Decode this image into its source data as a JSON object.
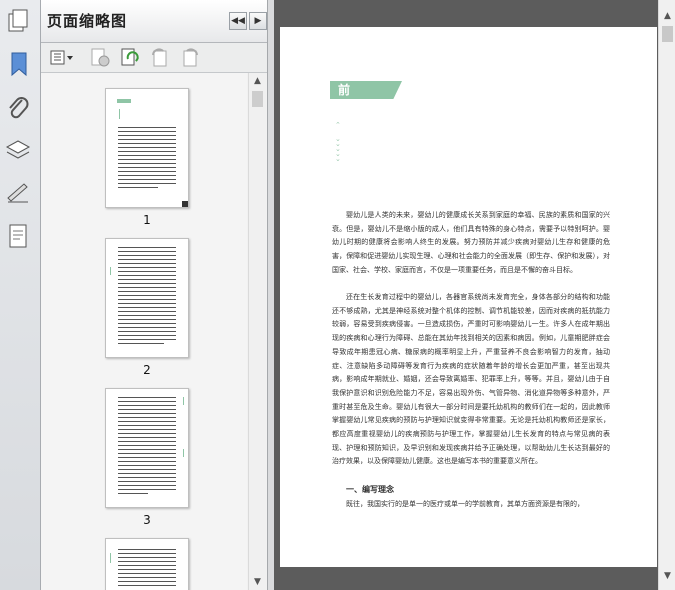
{
  "panel": {
    "title": "页面缩略图",
    "collapse_icon": "double-chevron-left-icon",
    "expand_icon": "chevron-right-icon"
  },
  "rail": {
    "icons": [
      "pages-icon",
      "bookmark-icon",
      "attachment-icon",
      "layers-icon",
      "signature-icon",
      "content-icon"
    ]
  },
  "toolbar": {
    "icons": [
      "options-menu-icon",
      "delete-pages-icon",
      "replace-pages-icon",
      "rotate-left-icon",
      "rotate-right-icon"
    ]
  },
  "thumbnails": [
    {
      "label": "1"
    },
    {
      "label": "2"
    },
    {
      "label": "3"
    },
    {
      "label": ""
    }
  ],
  "document": {
    "heading": "前 言",
    "paragraphs": [
      "婴幼儿是人类的未来，婴幼儿的健康成长关系到家庭的幸福、民族的素质和国家的兴衰。但是，婴幼儿不是缩小版的成人，他们具有特殊的身心特点，需要予以特别呵护。婴幼儿时期的健康将会影响人终生的发展。努力预防并减少疾病对婴幼儿生存和健康的危害，保障和促进婴幼儿实现生理、心理和社会能力的全面发展（即生存、保护和发展），对国家、社会、学校、家庭而言，不仅是一项重要任务，而且是不懈的奋斗目标。",
      "还在生长发育过程中的婴幼儿，各器官系统尚未发育完全，身体各部分的结构和功能还不够成熟，尤其是神经系统对整个机体的控制、调节机能较差，因而对疾病的抵抗能力较弱，容易受到疾病侵害。一旦造成损伤，严重时可影响婴幼儿一生。许多人在成年期出现的疾病和心理行为障碍、总能在其幼年找到相关的因素和病因。例如，儿童期肥胖症会导致成年期患冠心病、糖尿病的概率明显上升，严重营养不良会影响智力的发育，抽动症、注意缺陷多动障碍等发育行为疾病的症状随着年龄的增长会更加严重，甚至出现共病，影响成年期就业、婚姻，还会导致离婚率、犯罪率上升，等等。并且，婴幼儿由于自我保护意识和识别危险能力不足，容易出现外伤、气管异物、消化道异物等多种意外，严重时甚至危及生命。婴幼儿有很大一部分时间是要托幼机构的教师们在一起的，因此教师掌握婴幼儿常见疾病的预防与护理知识就变得非常重要。无论是托幼机构教师还是家长，都应高度重视婴幼儿的疾病预防与护理工作，掌握婴幼儿生长发育的特点与常见病的表现、护理和预防知识，及早识别和发现疾病并给予正确处理，以帮助幼儿生长达到最好的治疗效果，以及保障婴幼儿健康。这也是编写本书的重要意义所在。"
    ],
    "subheading": "一、编写理念",
    "last_line": "既往，我国实行的是单一的医疗或单一的学前教育，其单方面资源是有限的，"
  },
  "colors": {
    "heading_bg": "#8fc5a6",
    "doc_bg": "#5c5c5c",
    "panel_bg": "#f4f4f4"
  }
}
